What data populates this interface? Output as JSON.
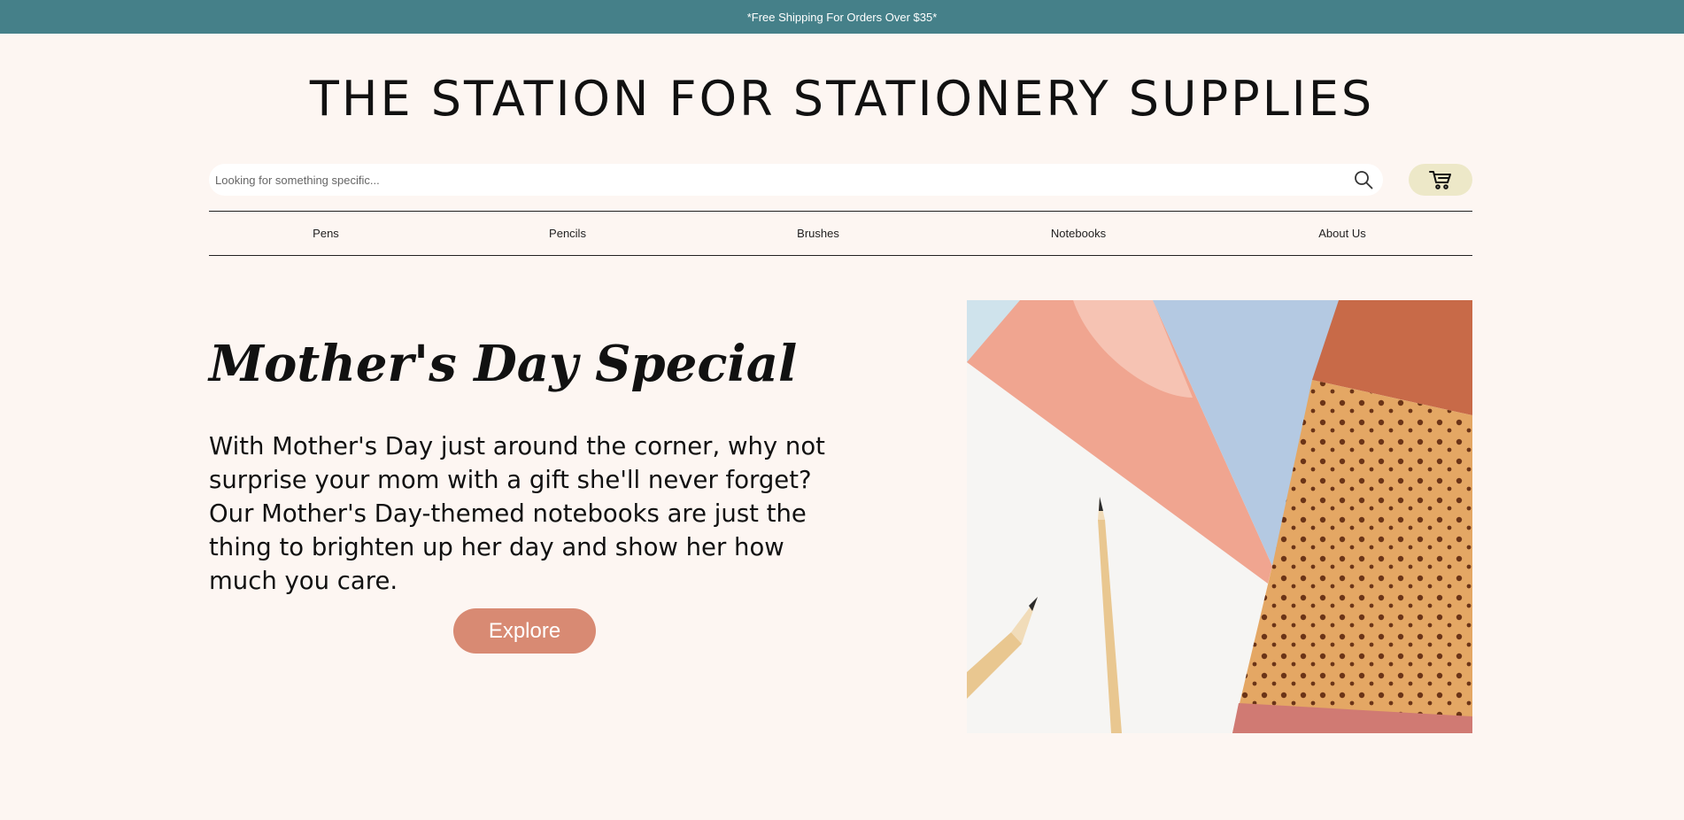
{
  "announcement": {
    "text": "*Free Shipping For Orders Over $35*"
  },
  "header": {
    "title": "THE STATION FOR STATIONERY SUPPLIES"
  },
  "search": {
    "placeholder": "Looking for something specific...",
    "value": "",
    "icon": "search-icon"
  },
  "cart": {
    "icon": "cart-icon"
  },
  "nav": {
    "items": [
      {
        "label": "Pens"
      },
      {
        "label": "Pencils"
      },
      {
        "label": "Brushes"
      },
      {
        "label": "Notebooks"
      },
      {
        "label": "About Us"
      }
    ]
  },
  "hero": {
    "title": "Mother's Day Special",
    "text": "With Mother's Day just around the corner, why not surprise your mom with a gift she'll never forget? Our Mother's Day-themed notebooks are just the thing to brighten up her day and show her how much you care.",
    "button_label": "Explore",
    "image": "notebooks-and-pencils-photo"
  },
  "colors": {
    "announcement_bg": "#458089",
    "page_bg": "#fdf6f2",
    "button": "#d88a73",
    "cart_bg": "#ede8c8"
  }
}
